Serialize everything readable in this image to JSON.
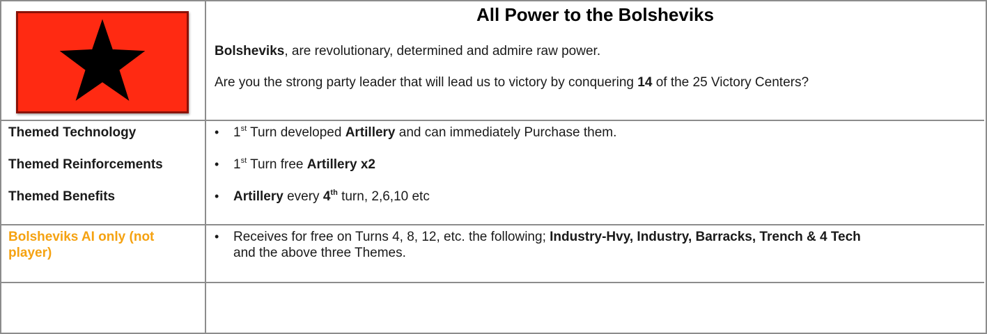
{
  "header": {
    "title": "All Power to the Bolsheviks",
    "intro": {
      "faction": "Bolsheviks",
      "description": ", are revolutionary, determined and admire raw power."
    },
    "question": {
      "prefix": "Are you the strong party leader that will lead us to victory  by conquering ",
      "target_count": "14",
      "suffix": " of the 25 Victory Centers?"
    }
  },
  "flag": {
    "icon": "black-star-icon",
    "background_color": "#ff2a12",
    "border_color": "#8a1208",
    "star_color": "#000000"
  },
  "labels": {
    "technology": "Themed Technology",
    "reinforcements": "Themed Reinforcements",
    "benefits": "Themed Benefits",
    "ai_only": "Bolsheviks AI only (not player)"
  },
  "themes": {
    "bullet_char": "•",
    "technology": {
      "ordinal_num": "1",
      "ordinal_suffix": "st",
      "before": " Turn developed ",
      "unit": "Artillery",
      "after": " and can immediately Purchase them."
    },
    "reinforcements": {
      "ordinal_num": "1",
      "ordinal_suffix": "st",
      "before": " Turn free ",
      "bold": "Artillery x2"
    },
    "benefits": {
      "unit": "Artillery",
      "middle": " every ",
      "ordinal_num": "4",
      "ordinal_suffix": "th",
      "after": " turn, 2,6,10 etc"
    }
  },
  "ai_bonus": {
    "line1_before": "Receives for free on Turns 4, 8, 12, etc.  the following; ",
    "line1_bold": "Industry-Hvy, Industry, Barracks, Trench & 4 Tech",
    "line2": "and the above three Themes."
  },
  "colors": {
    "accent_label": "#f5a211",
    "grid_line": "#8c8c8c"
  }
}
